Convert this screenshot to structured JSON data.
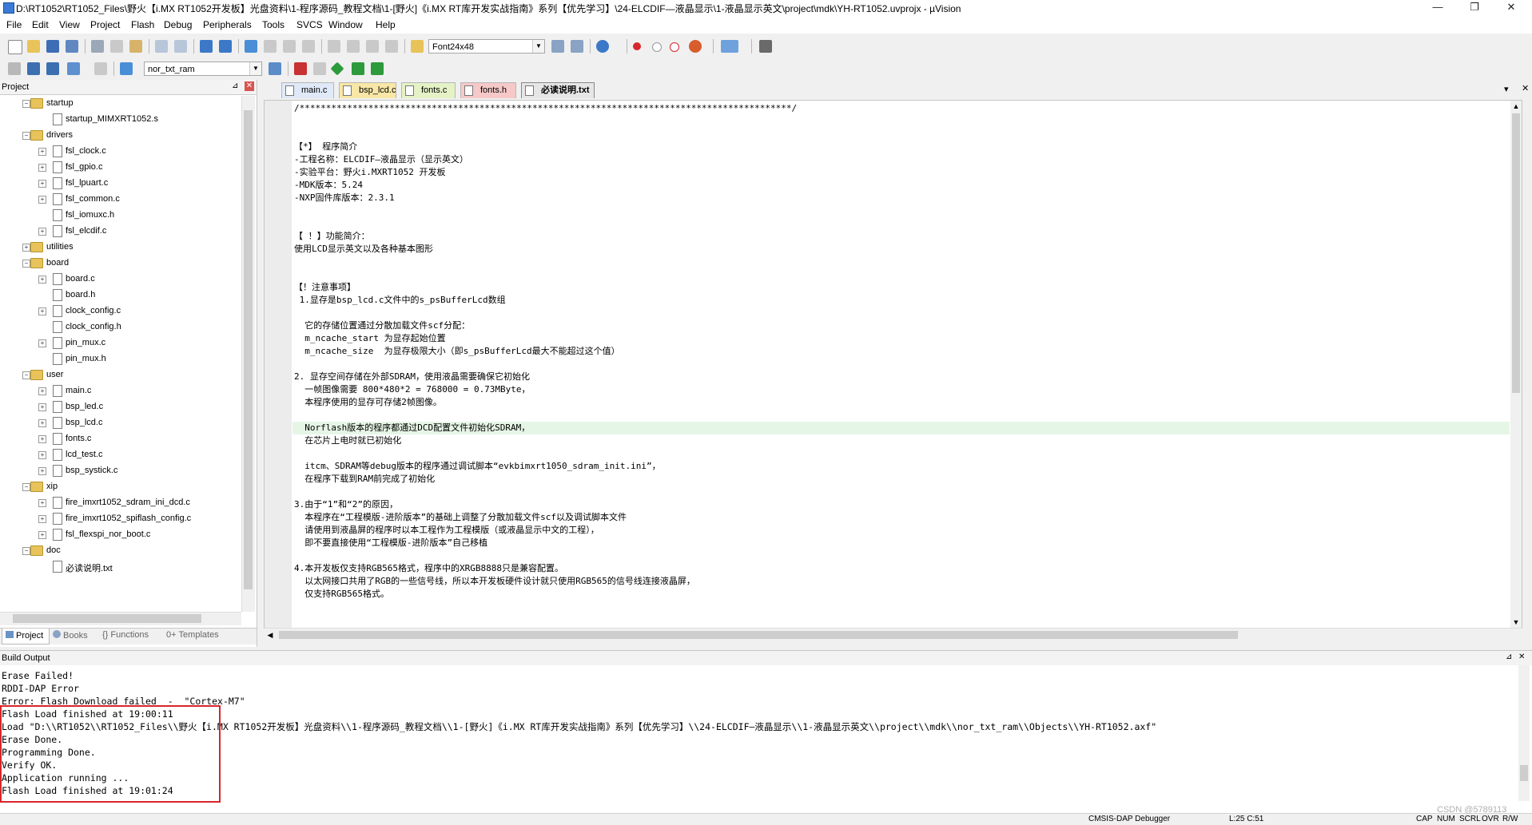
{
  "window": {
    "title": "D:\\RT1052\\RT1052_Files\\野火【i.MX RT1052开发板】光盘资料\\1-程序源码_教程文档\\1-[野火]《i.MX RT库开发实战指南》系列【优先学习】\\24-ELCDIF—液晶显示\\1-液晶显示英文\\project\\mdk\\YH-RT1052.uvprojx - µVision",
    "minimize": "—",
    "maximize": "❐",
    "close": "✕"
  },
  "menu": [
    "File",
    "Edit",
    "View",
    "Project",
    "Flash",
    "Debug",
    "Peripherals",
    "Tools",
    "SVCS",
    "Window",
    "Help"
  ],
  "toolbar1": {
    "find_combo": "Font24x48"
  },
  "toolbar2": {
    "target_combo": "nor_txt_ram"
  },
  "project_panel": {
    "title": "Project",
    "pin": "⊿",
    "close": "✕",
    "tree": [
      {
        "label": "startup",
        "type": "folder",
        "level": 1,
        "expand": "−"
      },
      {
        "label": "startup_MIMXRT1052.s",
        "type": "file",
        "level": 2,
        "expand": ""
      },
      {
        "label": "drivers",
        "type": "folder",
        "level": 1,
        "expand": "−"
      },
      {
        "label": "fsl_clock.c",
        "type": "file",
        "level": 2,
        "expand": "+"
      },
      {
        "label": "fsl_gpio.c",
        "type": "file",
        "level": 2,
        "expand": "+"
      },
      {
        "label": "fsl_lpuart.c",
        "type": "file",
        "level": 2,
        "expand": "+"
      },
      {
        "label": "fsl_common.c",
        "type": "file",
        "level": 2,
        "expand": "+"
      },
      {
        "label": "fsl_iomuxc.h",
        "type": "file",
        "level": 2,
        "expand": ""
      },
      {
        "label": "fsl_elcdif.c",
        "type": "file",
        "level": 2,
        "expand": "+"
      },
      {
        "label": "utilities",
        "type": "folder",
        "level": 1,
        "expand": "+"
      },
      {
        "label": "board",
        "type": "folder",
        "level": 1,
        "expand": "−"
      },
      {
        "label": "board.c",
        "type": "file",
        "level": 2,
        "expand": "+"
      },
      {
        "label": "board.h",
        "type": "file",
        "level": 2,
        "expand": ""
      },
      {
        "label": "clock_config.c",
        "type": "file",
        "level": 2,
        "expand": "+"
      },
      {
        "label": "clock_config.h",
        "type": "file",
        "level": 2,
        "expand": ""
      },
      {
        "label": "pin_mux.c",
        "type": "file",
        "level": 2,
        "expand": "+"
      },
      {
        "label": "pin_mux.h",
        "type": "file",
        "level": 2,
        "expand": ""
      },
      {
        "label": "user",
        "type": "folder",
        "level": 1,
        "expand": "−"
      },
      {
        "label": "main.c",
        "type": "file",
        "level": 2,
        "expand": "+"
      },
      {
        "label": "bsp_led.c",
        "type": "file",
        "level": 2,
        "expand": "+"
      },
      {
        "label": "bsp_lcd.c",
        "type": "file",
        "level": 2,
        "expand": "+"
      },
      {
        "label": "fonts.c",
        "type": "file",
        "level": 2,
        "expand": "+"
      },
      {
        "label": "lcd_test.c",
        "type": "file",
        "level": 2,
        "expand": "+"
      },
      {
        "label": "bsp_systick.c",
        "type": "file",
        "level": 2,
        "expand": "+"
      },
      {
        "label": "xip",
        "type": "folder",
        "level": 1,
        "expand": "−"
      },
      {
        "label": "fire_imxrt1052_sdram_ini_dcd.c",
        "type": "file",
        "level": 2,
        "expand": "+"
      },
      {
        "label": "fire_imxrt1052_spiflash_config.c",
        "type": "file",
        "level": 2,
        "expand": "+"
      },
      {
        "label": "fsl_flexspi_nor_boot.c",
        "type": "file",
        "level": 2,
        "expand": "+"
      },
      {
        "label": "doc",
        "type": "folder",
        "level": 1,
        "expand": "−"
      },
      {
        "label": "必读说明.txt",
        "type": "file",
        "level": 2,
        "expand": ""
      }
    ],
    "bottom_tabs": [
      "Project",
      "Books",
      "Functions",
      "Templates"
    ]
  },
  "editor": {
    "tabs": [
      {
        "label": "main.c",
        "color": "#dfe9f7",
        "active": false
      },
      {
        "label": "bsp_lcd.c",
        "color": "#f8e7a6",
        "active": false
      },
      {
        "label": "fonts.c",
        "color": "#e4f2c6",
        "active": false
      },
      {
        "label": "fonts.h",
        "color": "#f6c8c8",
        "active": false
      },
      {
        "label": "必读说明.txt",
        "color": "#e6e6e6",
        "active": true
      }
    ],
    "tabs_dropdown": "▾",
    "tabs_close": "✕",
    "highlight_line": 24,
    "lines": [
      "/*********************************************************************************************/",
      "",
      "",
      "【*】 程序简介",
      "-工程名称：ELCDIF—液晶显示（显示英文）",
      "-实验平台：野火i.MXRT1052 开发板",
      "-MDK版本：5.24",
      "-NXP固件库版本：2.3.1",
      "",
      "",
      "【 ！】功能简介：",
      "使用LCD显示英文以及各种基本图形",
      "",
      "",
      "【！注意事项】",
      " 1.显存是bsp_lcd.c文件中的s_psBufferLcd数组",
      "",
      "  它的存储位置通过分散加载文件scf分配：",
      "  m_ncache_start 为显存起始位置",
      "  m_ncache_size  为显存极限大小（即s_psBufferLcd最大不能超过这个值）",
      "",
      "2. 显存空间存储在外部SDRAM，使用液晶需要确保它初始化",
      "  一帧图像需要 800*480*2 = 768000 = 0.73MByte，",
      "  本程序使用的显存可存储2帧图像。",
      "",
      "  Norflash版本的程序都通过DCD配置文件初始化SDRAM，",
      "  在芯片上电时就已初始化",
      "",
      "  itcm、SDRAM等debug版本的程序通过调试脚本“evkbimxrt1050_sdram_init.ini”，",
      "  在程序下载到RAM前完成了初始化",
      "",
      "3.由于“1”和“2”的原因，",
      "  本程序在“工程模版-进阶版本”的基础上调整了分散加载文件scf以及调试脚本文件",
      "  请使用到液晶屏的程序时以本工程作为工程模版（或液晶显示中文的工程），",
      "  即不要直接使用“工程模版-进阶版本”自己移植",
      "",
      "4.本开发板仅支持RGB565格式，程序中的XRGB8888只是兼容配置。",
      "  以太网接口共用了RGB的一些信号线，所以本开发板硬件设计就只使用RGB565的信号线连接液晶屏，",
      "  仅支持RGB565格式。"
    ]
  },
  "build_output": {
    "title": "Build Output",
    "lines": [
      "Erase Failed!",
      "RDDI-DAP Error",
      "Error: Flash Download failed  -  \"Cortex-M7\"",
      "Flash Load finished at 19:00:11",
      "Load \"D:\\\\RT1052\\\\RT1052_Files\\\\野火【i.MX RT1052开发板】光盘资料\\\\1-程序源码_教程文档\\\\1-[野火]《i.MX RT库开发实战指南》系列【优先学习】\\\\24-ELCDIF—液晶显示\\\\1-液晶显示英文\\\\project\\\\mdk\\\\nor_txt_ram\\\\Objects\\\\YH-RT1052.axf\"",
      "Erase Done.",
      "Programming Done.",
      "Verify OK.",
      "Application running ...",
      "Flash Load finished at 19:01:24"
    ]
  },
  "statusbar": {
    "debugger": "CMSIS-DAP Debugger",
    "position": "L:25 C:51",
    "caps": "CAP",
    "num": "NUM",
    "scrl": "SCRL",
    "ovr": "OVR",
    "rw": "R/W",
    "watermark": "CSDN @5789113"
  },
  "colors": {
    "highlight": "#e6f6e6",
    "redbox": "#d9252a"
  }
}
